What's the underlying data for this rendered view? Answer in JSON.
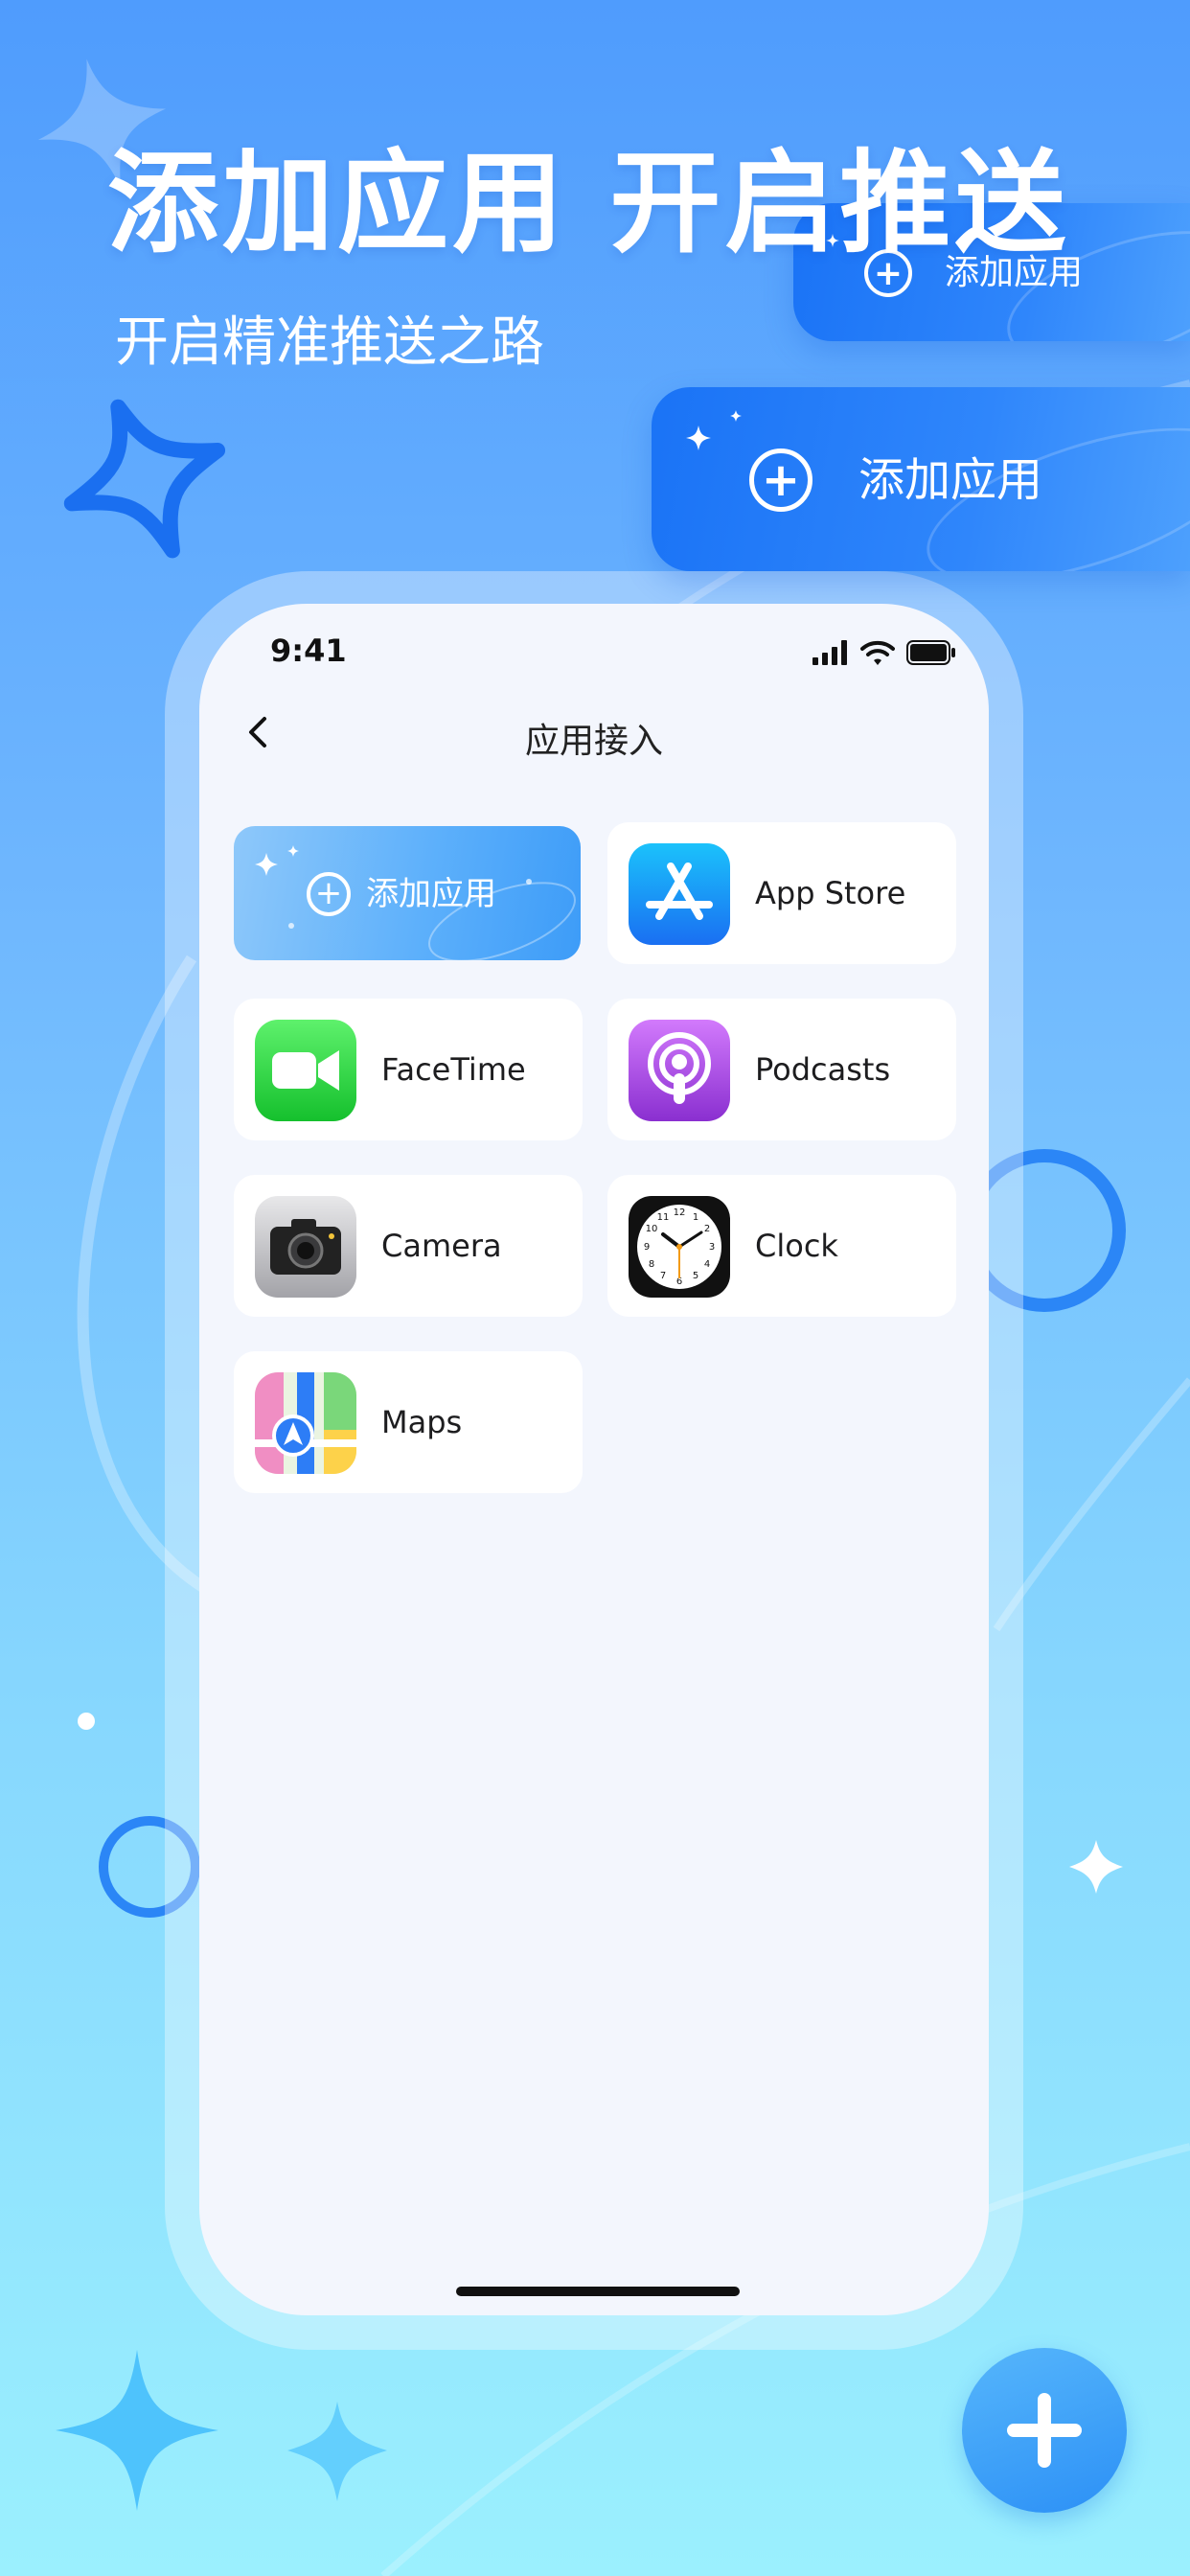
{
  "hero": {
    "headline": "添加应用  开启推送",
    "subhead": "开启精准推送之路"
  },
  "floating_cards": {
    "small_label": "添加应用",
    "large_label": "添加应用"
  },
  "phone": {
    "status": {
      "time": "9:41"
    },
    "nav": {
      "title": "应用接入"
    },
    "add_app_label": "添加应用",
    "apps": [
      {
        "name": "App Store",
        "icon": "app-store-icon"
      },
      {
        "name": "FaceTime",
        "icon": "facetime-icon"
      },
      {
        "name": "Podcasts",
        "icon": "podcasts-icon"
      },
      {
        "name": "Camera",
        "icon": "camera-icon"
      },
      {
        "name": "Clock",
        "icon": "clock-icon"
      },
      {
        "name": "Maps",
        "icon": "maps-icon"
      }
    ]
  },
  "colors": {
    "accent": "#1a73f6",
    "background_top": "#4f9cfd",
    "background_bottom": "#9bf0fe",
    "screen": "#f3f6fd"
  }
}
